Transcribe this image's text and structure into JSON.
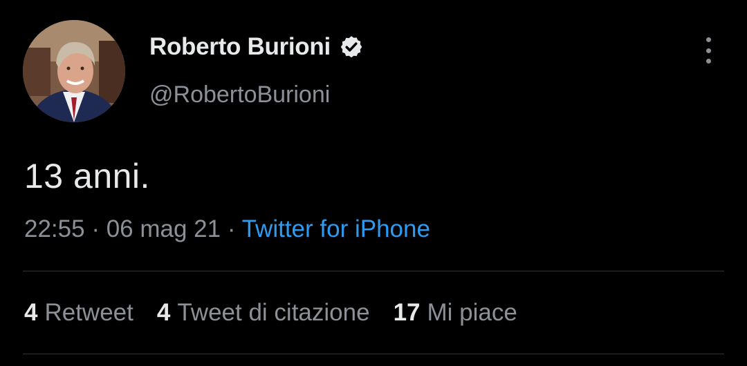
{
  "author": {
    "display_name": "Roberto Burioni",
    "handle": "@RobertoBurioni",
    "verified": true,
    "avatar_icon": "profile-photo"
  },
  "tweet": {
    "text": "13 anni.",
    "time": "22:55",
    "date": "06 mag 21",
    "separator": "·",
    "source": "Twitter for iPhone"
  },
  "stats": [
    {
      "count": "4",
      "label": "Retweet"
    },
    {
      "count": "4",
      "label": "Tweet di citazione"
    },
    {
      "count": "17",
      "label": "Mi piace"
    }
  ],
  "colors": {
    "background": "#000000",
    "primary_text": "#e7e9ea",
    "secondary_text": "#8b9197",
    "link": "#2f9bf0",
    "divider": "#2f3336"
  },
  "icons": {
    "verified": "verified-badge-icon",
    "more": "more-vertical-icon"
  }
}
